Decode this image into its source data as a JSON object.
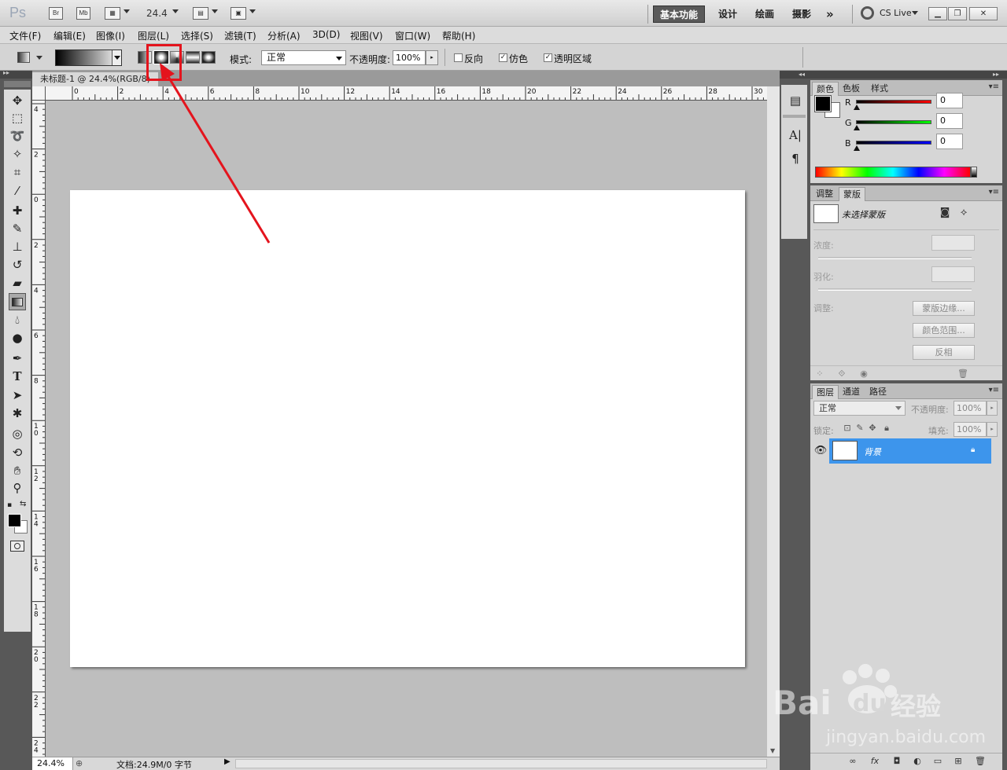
{
  "app": {
    "logo": "Ps",
    "bridge_icon": "Br",
    "minibridge_icon": "Mb",
    "zoom": "24.4",
    "workspaces": [
      "基本功能",
      "设计",
      "绘画",
      "摄影"
    ],
    "more": "»",
    "cs_live": "CS Live",
    "window_buttons": [
      "minimize",
      "restore",
      "close"
    ]
  },
  "menu": [
    "文件(F)",
    "编辑(E)",
    "图像(I)",
    "图层(L)",
    "选择(S)",
    "滤镜(T)",
    "分析(A)",
    "3D(D)",
    "视图(V)",
    "窗口(W)",
    "帮助(H)"
  ],
  "options": {
    "mode_label": "模式:",
    "mode_value": "正常",
    "opacity_label": "不透明度:",
    "opacity_value": "100%",
    "reverse_label": "反向",
    "reverse_checked": false,
    "dither_label": "仿色",
    "dither_checked": true,
    "transparency_label": "透明区域",
    "transparency_checked": true,
    "gradient_types": [
      "linear",
      "radial",
      "angle",
      "reflected",
      "diamond"
    ],
    "selected_gradient_type": "radial"
  },
  "annotation": {
    "color": "#e4141d"
  },
  "document": {
    "tab_title": "未标题-1 @ 24.4%(RGB/8)",
    "ruler_h_labels": [
      "0",
      "2",
      "4",
      "6",
      "8",
      "10",
      "12",
      "14",
      "16",
      "18",
      "20",
      "22",
      "24",
      "26",
      "28",
      "30"
    ],
    "ruler_v_labels": [
      "4",
      "2",
      "0",
      "2",
      "4",
      "6",
      "8",
      "10",
      "12",
      "14",
      "16",
      "18",
      "20",
      "22",
      "24"
    ],
    "status_zoom": "24.4%",
    "status_doc": "文档:24.9M/0 字节"
  },
  "color_panel": {
    "tabs": [
      "颜色",
      "色板",
      "样式"
    ],
    "active_tab": "颜色",
    "channels": [
      {
        "label": "R",
        "value": "0",
        "color": "#e00000"
      },
      {
        "label": "G",
        "value": "0",
        "color": "#00c000"
      },
      {
        "label": "B",
        "value": "0",
        "color": "#0000e0"
      }
    ]
  },
  "masks_panel": {
    "tabs": [
      "调整",
      "蒙版"
    ],
    "active_tab": "蒙版",
    "title": "未选择蒙版",
    "density_label": "浓度:",
    "feather_label": "羽化:",
    "refine_label": "调整:",
    "buttons": [
      "蒙版边缘...",
      "颜色范围...",
      "反相"
    ]
  },
  "layers_panel": {
    "tabs": [
      "图层",
      "通道",
      "路径"
    ],
    "active_tab": "图层",
    "blend_mode": "正常",
    "opacity_label": "不透明度:",
    "opacity_value": "100%",
    "lock_label": "锁定:",
    "fill_label": "填充:",
    "fill_value": "100%",
    "layers": [
      {
        "name": "背景",
        "selected": true,
        "locked": true
      }
    ]
  },
  "watermark": {
    "brand": "Bai",
    "brand2": "du",
    "site_cn": "经验",
    "url": "jingyan.baidu.com"
  }
}
